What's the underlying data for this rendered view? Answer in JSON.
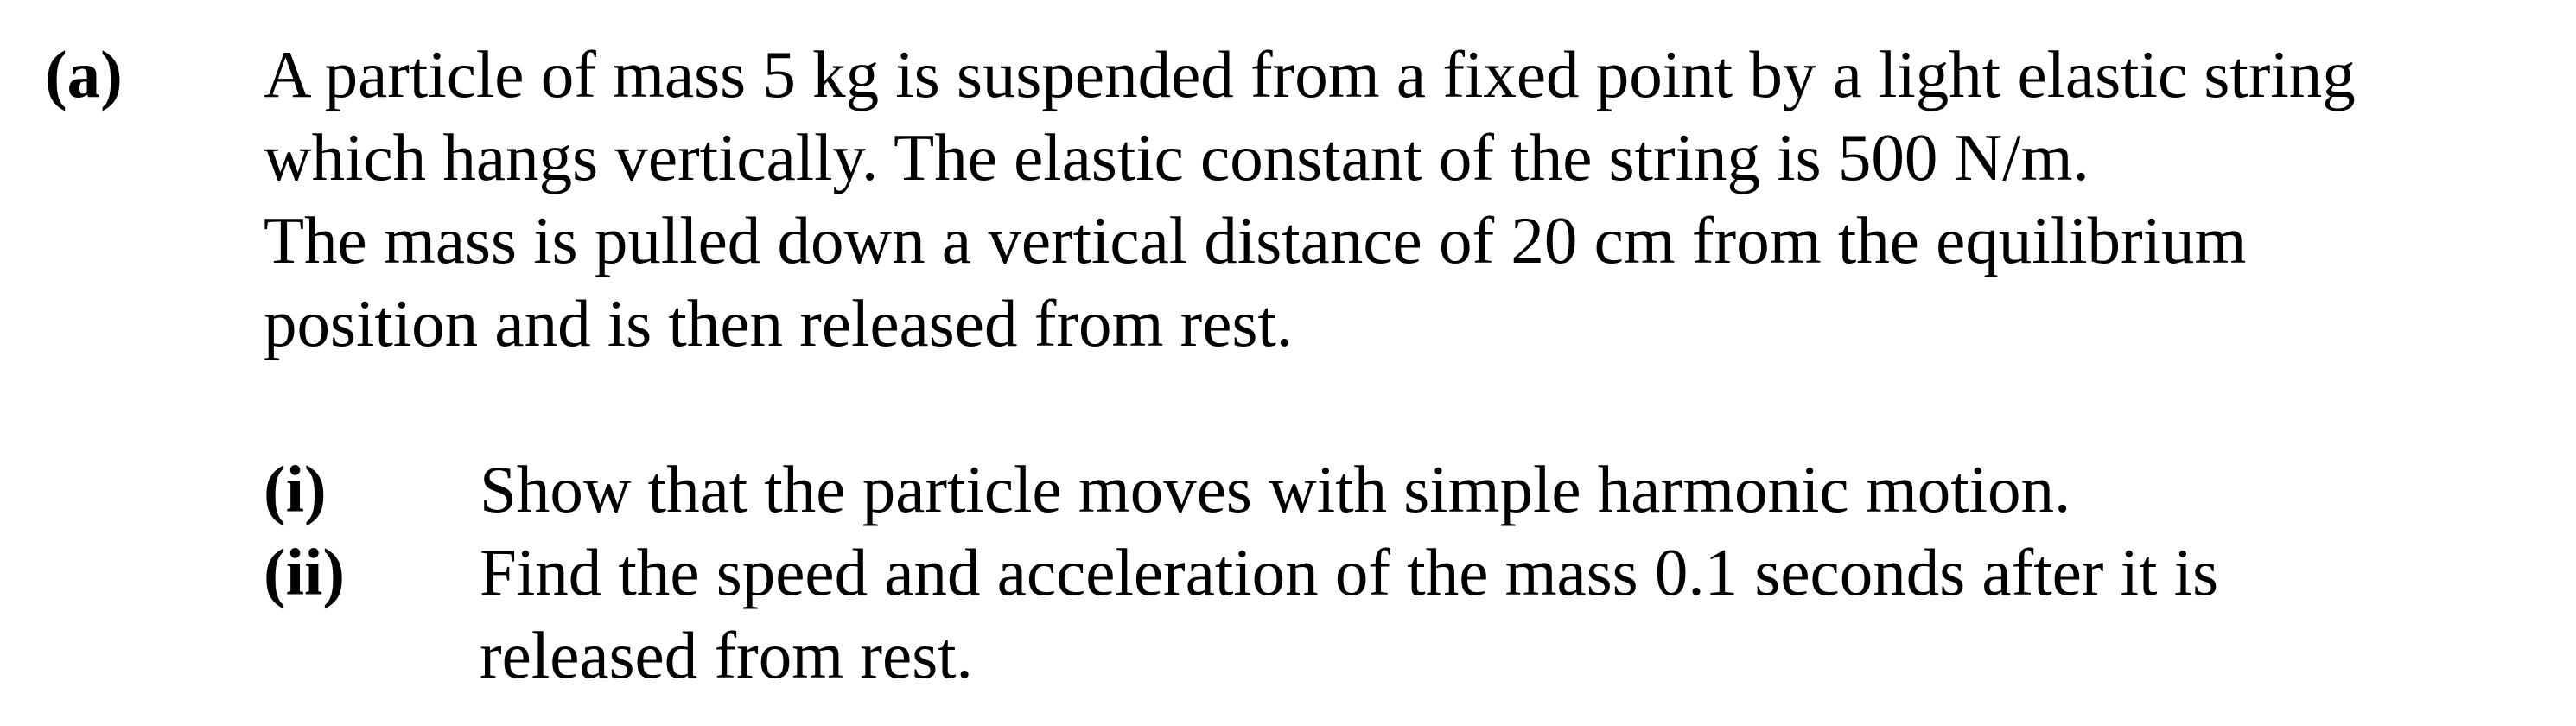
{
  "question": {
    "part_label": "(a)",
    "stem_lines": [
      "A particle of mass 5 kg is suspended from a fixed point by a light elastic string",
      "which hangs vertically.  The elastic constant of the string is 500 N/m.",
      "The mass is pulled down a vertical distance of 20 cm from the equilibrium",
      "position and is then released from rest."
    ],
    "subparts": [
      {
        "label": "(i)",
        "lines": [
          "Show that the particle moves with simple harmonic motion."
        ]
      },
      {
        "label": "(ii)",
        "lines": [
          "Find the speed and acceleration of the mass 0.1 seconds after it is",
          "released from rest."
        ]
      }
    ]
  }
}
